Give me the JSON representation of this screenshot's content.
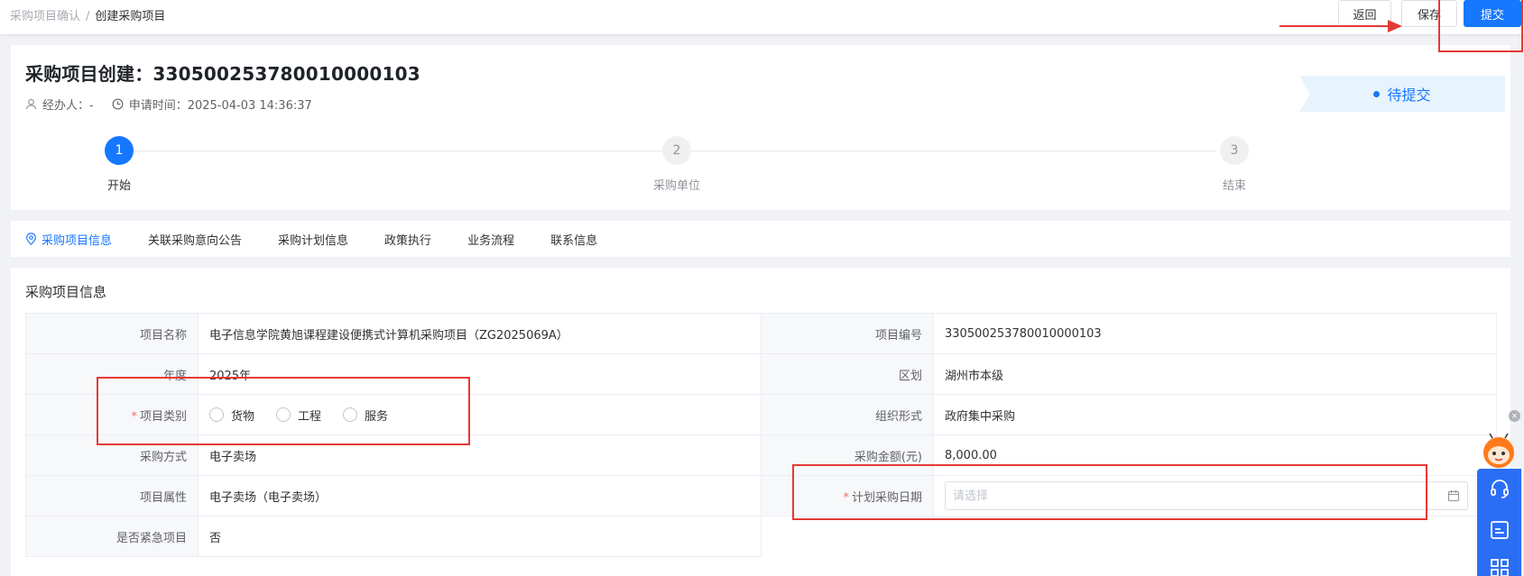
{
  "breadcrumb": {
    "parent": "采购项目确认",
    "separator": "/",
    "current": "创建采购项目"
  },
  "toolbar": {
    "back_label": "返回",
    "save_label": "保存",
    "submit_label": "提交"
  },
  "header": {
    "title": "采购项目创建：330500253780010000103",
    "handler": "经办人：-",
    "apply_time": "申请时间：2025-04-03 14:36:37",
    "status": "待提交"
  },
  "steps": [
    {
      "num": "1",
      "label": "开始"
    },
    {
      "num": "2",
      "label": "采购单位"
    },
    {
      "num": "3",
      "label": "结束"
    }
  ],
  "tabs": [
    "采购项目信息",
    "关联采购意向公告",
    "采购计划信息",
    "政策执行",
    "业务流程",
    "联系信息"
  ],
  "section": {
    "title": "采购项目信息",
    "fields": {
      "project_name_label": "项目名称",
      "project_name": "电子信息学院黄旭课程建设便携式计算机采购项目（ZG2025069A）",
      "project_no_label": "项目编号",
      "project_no": "330500253780010000103",
      "year_label": "年度",
      "year": "2025年",
      "district_label": "区划",
      "district": "湖州市本级",
      "category_label": "项目类别",
      "category_options": [
        "货物",
        "工程",
        "服务"
      ],
      "org_form_label": "组织形式",
      "org_form": "政府集中采购",
      "method_label": "采购方式",
      "method": "电子卖场",
      "amount_label": "采购金额(元)",
      "amount": "8,000.00",
      "attribute_label": "项目属性",
      "attribute": "电子卖场（电子卖场）",
      "plan_date_label": "计划采购日期",
      "plan_date_placeholder": "请选择",
      "urgent_label": "是否紧急项目",
      "urgent": "否"
    }
  },
  "required_mark": "*",
  "colors": {
    "primary": "#1677ff",
    "money": "#e6a23c",
    "required": "#f56c6c",
    "annotation": "#e53935"
  }
}
